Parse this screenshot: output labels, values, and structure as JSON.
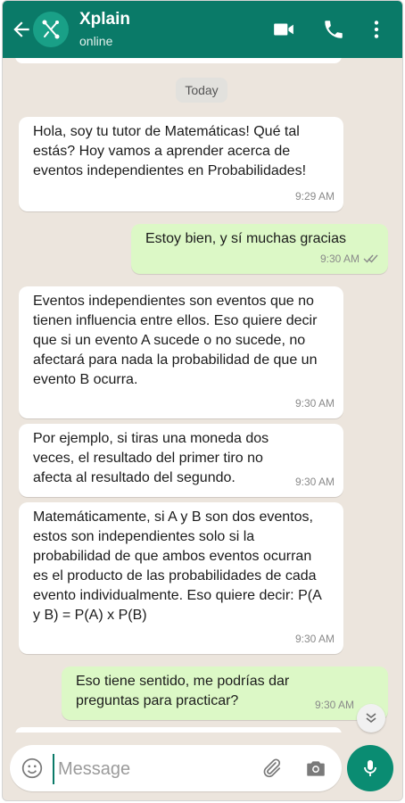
{
  "header": {
    "title": "Xplain",
    "status": "online",
    "back_icon": "arrow-left-icon",
    "video_icon": "video-call-icon",
    "phone_icon": "phone-icon",
    "menu_icon": "more-vertical-icon",
    "accent_color": "#0a7a68"
  },
  "chat": {
    "date_label": "Today",
    "messages": [
      {
        "direction": "in",
        "text": "Hola, soy tu tutor de Matemáticas! Qué tal estás? Hoy vamos a aprender acerca de eventos independientes en Probabilidades!",
        "time": "9:29 AM"
      },
      {
        "direction": "out",
        "text": "Estoy bien, y sí muchas gracias",
        "time": "9:30 AM",
        "ticks": "double-check-icon"
      },
      {
        "direction": "in",
        "text": "Eventos independientes son eventos que no tienen influencia entre ellos. Eso quiere decir que si un evento A sucede o no sucede, no afectará para nada la probabilidad de que un evento B ocurra.",
        "time": "9:30 AM"
      },
      {
        "direction": "in",
        "text": "Por ejemplo, si tiras una moneda dos veces, el resultado del primer tiro no afecta al resultado del segundo.",
        "time": "9:30 AM"
      },
      {
        "direction": "in",
        "text": "Matemáticamente, si A y B son dos eventos, estos son independientes solo si la probabilidad de que ambos eventos ocurran es el producto de las probabilidades de cada evento individualmente. Eso quiere decir: P(A y B) = P(A) x P(B)",
        "time": "9:30 AM"
      },
      {
        "direction": "out",
        "text": "Eso tiene sentido, me podrías dar preguntas para practicar?",
        "time": "9:30 AM"
      }
    ]
  },
  "composer": {
    "placeholder": "Message",
    "emoji_icon": "emoji-icon",
    "attach_icon": "paperclip-icon",
    "camera_icon": "camera-icon",
    "mic_icon": "microphone-icon",
    "scroll_icon": "double-chevron-down-icon"
  }
}
